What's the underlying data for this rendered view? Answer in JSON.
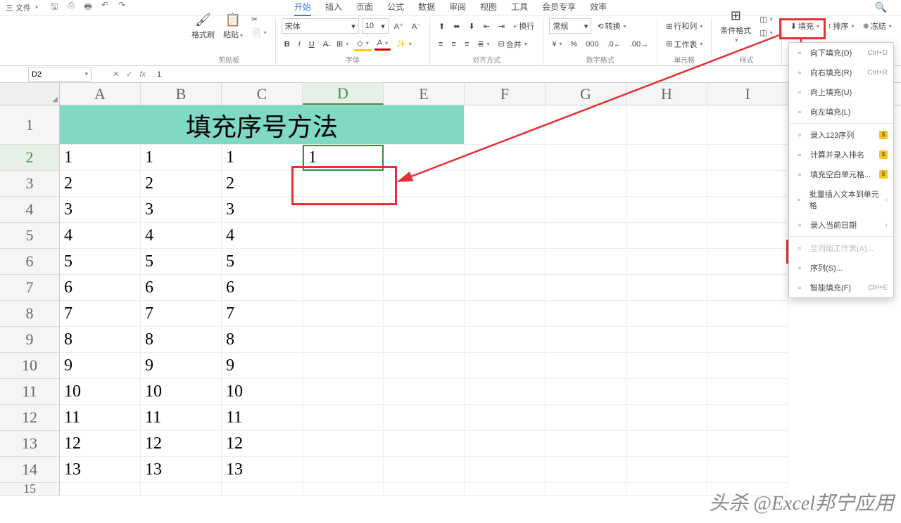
{
  "topbar": {
    "file_label": "三 文件",
    "tabs": [
      "开始",
      "插入",
      "页面",
      "公式",
      "数据",
      "审阅",
      "视图",
      "工具",
      "会员专享",
      "效率"
    ],
    "active_tab": 0
  },
  "ribbon": {
    "clipboard": {
      "format_painter": "格式刷",
      "paste": "粘贴",
      "label": "剪贴板"
    },
    "font": {
      "name": "宋体",
      "size": "10",
      "label": "字体"
    },
    "align": {
      "wrap": "换行",
      "merge": "合并",
      "label": "对齐方式"
    },
    "number": {
      "general": "常规",
      "convert": "转换",
      "label": "数字格式"
    },
    "cells": {
      "rowcol": "行和列",
      "worksheet": "工作表",
      "label": "单元格"
    },
    "styles": {
      "condfmt": "条件格式",
      "label": "样式"
    },
    "fill": {
      "label": "填充"
    },
    "sort": {
      "label": "排序"
    },
    "freeze": {
      "label": "冻结"
    }
  },
  "formula": {
    "cell_ref": "D2",
    "fx": "fx",
    "value": "1"
  },
  "columns": [
    "A",
    "B",
    "C",
    "D",
    "E",
    "F",
    "G",
    "H",
    "I"
  ],
  "title_cell": "填充序号方法",
  "data_rows": [
    [
      "1",
      "1",
      "1",
      "1"
    ],
    [
      "2",
      "2",
      "2",
      ""
    ],
    [
      "3",
      "3",
      "3",
      ""
    ],
    [
      "4",
      "4",
      "4",
      ""
    ],
    [
      "5",
      "5",
      "5",
      ""
    ],
    [
      "6",
      "6",
      "6",
      ""
    ],
    [
      "7",
      "7",
      "7",
      ""
    ],
    [
      "8",
      "8",
      "8",
      ""
    ],
    [
      "9",
      "9",
      "9",
      ""
    ],
    [
      "10",
      "10",
      "10",
      ""
    ],
    [
      "11",
      "11",
      "11",
      ""
    ],
    [
      "12",
      "12",
      "12",
      ""
    ],
    [
      "13",
      "13",
      "13",
      ""
    ]
  ],
  "menu": {
    "items": [
      {
        "label": "向下填充(D)",
        "shortcut": "Ctrl+D",
        "arrow": false
      },
      {
        "label": "向右填充(R)",
        "shortcut": "Ctrl+R",
        "arrow": false
      },
      {
        "label": "向上填充(U)",
        "shortcut": "",
        "arrow": false
      },
      {
        "label": "向左填充(L)",
        "shortcut": "",
        "arrow": false
      },
      {
        "sep": true
      },
      {
        "label": "录入123序列",
        "shortcut": "",
        "badge": true
      },
      {
        "label": "计算并录入排名",
        "shortcut": "",
        "badge": true
      },
      {
        "label": "填充空白单元格...",
        "shortcut": "",
        "badge": true
      },
      {
        "label": "批量插入文本到单元格",
        "shortcut": "",
        "arrow": true
      },
      {
        "label": "录入当前日期",
        "shortcut": "",
        "arrow": true
      },
      {
        "sep": true
      },
      {
        "label": "至同组工作表(A)...",
        "shortcut": "",
        "disabled": true
      },
      {
        "label": "序列(S)...",
        "shortcut": "",
        "highlight": true
      },
      {
        "label": "智能填充(F)",
        "shortcut": "Ctrl+E"
      }
    ]
  },
  "watermark": "头杀 @Excel邦宁应用"
}
